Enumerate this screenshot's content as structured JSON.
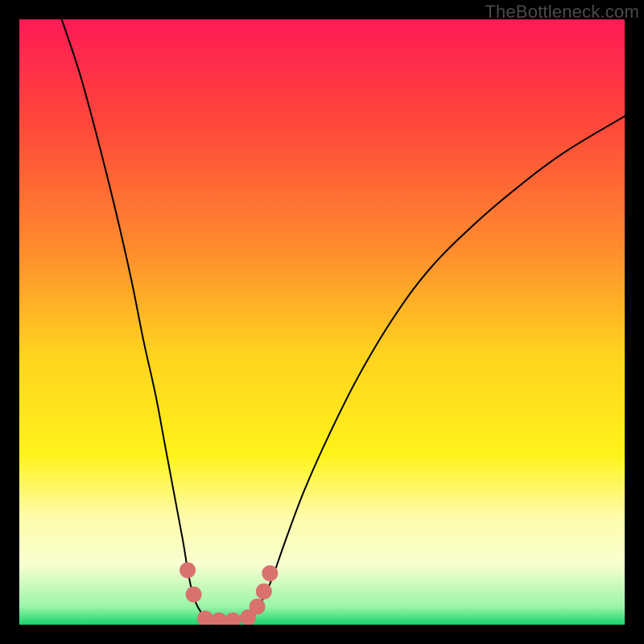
{
  "watermark": "TheBottleneck.com",
  "chart_data": {
    "type": "line",
    "title": "",
    "xlabel": "",
    "ylabel": "",
    "xlim": [
      0,
      100
    ],
    "ylim": [
      0,
      100
    ],
    "grid": false,
    "legend": false,
    "background_gradient": {
      "stops": [
        {
          "offset": 0.0,
          "color": "#ff1a55"
        },
        {
          "offset": 0.18,
          "color": "#ff4a3a"
        },
        {
          "offset": 0.38,
          "color": "#ff8c2e"
        },
        {
          "offset": 0.55,
          "color": "#ffd21f"
        },
        {
          "offset": 0.72,
          "color": "#fff31a"
        },
        {
          "offset": 0.82,
          "color": "#fffca8"
        },
        {
          "offset": 0.9,
          "color": "#f8ffd0"
        },
        {
          "offset": 0.97,
          "color": "#9bf5a8"
        },
        {
          "offset": 1.0,
          "color": "#17d46a"
        }
      ]
    },
    "series": [
      {
        "name": "left-curve",
        "color": "#000000",
        "width": 2,
        "points": [
          {
            "x": 7.0,
            "y": 100.0
          },
          {
            "x": 10.0,
            "y": 91.0
          },
          {
            "x": 13.0,
            "y": 80.0
          },
          {
            "x": 16.0,
            "y": 68.0
          },
          {
            "x": 18.5,
            "y": 57.0
          },
          {
            "x": 20.5,
            "y": 47.0
          },
          {
            "x": 22.5,
            "y": 38.0
          },
          {
            "x": 24.0,
            "y": 30.0
          },
          {
            "x": 25.5,
            "y": 22.0
          },
          {
            "x": 27.0,
            "y": 14.0
          },
          {
            "x": 28.0,
            "y": 8.0
          },
          {
            "x": 29.0,
            "y": 4.0
          },
          {
            "x": 30.5,
            "y": 1.5
          },
          {
            "x": 32.5,
            "y": 0.5
          },
          {
            "x": 35.0,
            "y": 0.5
          }
        ]
      },
      {
        "name": "right-curve",
        "color": "#000000",
        "width": 2,
        "points": [
          {
            "x": 35.0,
            "y": 0.5
          },
          {
            "x": 37.5,
            "y": 1.0
          },
          {
            "x": 39.5,
            "y": 3.0
          },
          {
            "x": 41.5,
            "y": 7.0
          },
          {
            "x": 44.0,
            "y": 14.0
          },
          {
            "x": 47.0,
            "y": 22.0
          },
          {
            "x": 51.0,
            "y": 31.0
          },
          {
            "x": 56.0,
            "y": 41.0
          },
          {
            "x": 62.0,
            "y": 51.0
          },
          {
            "x": 68.0,
            "y": 59.0
          },
          {
            "x": 75.0,
            "y": 66.0
          },
          {
            "x": 82.0,
            "y": 72.0
          },
          {
            "x": 90.0,
            "y": 78.0
          },
          {
            "x": 100.0,
            "y": 84.0
          }
        ]
      }
    ],
    "markers": {
      "name": "bottom-markers",
      "color": "#d9716d",
      "radius": 10,
      "points": [
        {
          "x": 27.8,
          "y": 9.0
        },
        {
          "x": 28.8,
          "y": 5.0
        },
        {
          "x": 30.7,
          "y": 1.0
        },
        {
          "x": 33.0,
          "y": 0.7
        },
        {
          "x": 35.3,
          "y": 0.7
        },
        {
          "x": 37.8,
          "y": 1.2
        },
        {
          "x": 39.3,
          "y": 3.0
        },
        {
          "x": 40.4,
          "y": 5.5
        },
        {
          "x": 41.4,
          "y": 8.5
        }
      ]
    }
  }
}
